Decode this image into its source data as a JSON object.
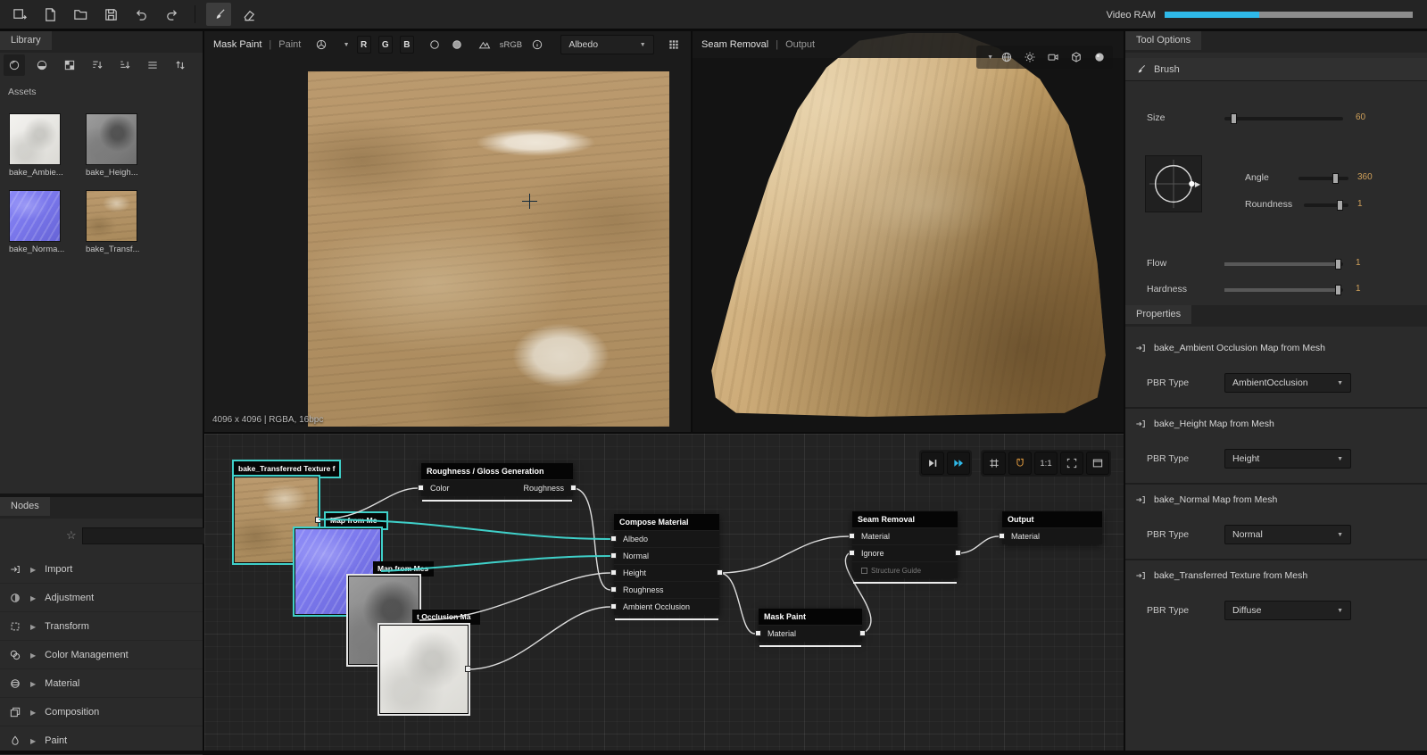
{
  "colors": {
    "accent_cyan": "#2fb9e8",
    "wire_teal": "#3fd0c9",
    "value_amber": "#cfa05a",
    "rock_tan": "#c3a06c"
  },
  "topbar": {
    "video_ram_label": "Video RAM"
  },
  "library": {
    "tab": "Library",
    "assets_label": "Assets",
    "assets": [
      {
        "name": "bake_Ambie..."
      },
      {
        "name": "bake_Heigh..."
      },
      {
        "name": "bake_Norma..."
      },
      {
        "name": "bake_Transf..."
      }
    ]
  },
  "nodes_panel": {
    "tab": "Nodes",
    "categories": [
      "Import",
      "Adjustment",
      "Transform",
      "Color Management",
      "Material",
      "Composition",
      "Paint"
    ]
  },
  "view2d": {
    "title": "Mask Paint",
    "sep": "|",
    "subtitle": "Paint",
    "channels": [
      "R",
      "G",
      "B"
    ],
    "srgb": "sRGB",
    "map_select": "Albedo",
    "status": "4096 x 4096 | RGBA, 16bpc"
  },
  "view3d": {
    "title": "Seam Removal",
    "sep": "|",
    "subtitle": "Output"
  },
  "graph": {
    "zoom_label": "1:1",
    "transferred": {
      "title": "bake_Transferred Texture f"
    },
    "normal": {
      "title": "Map from Me"
    },
    "height": {
      "title": "Map from Mes"
    },
    "ao": {
      "title": "t Occlusion Ma"
    },
    "rough": {
      "title": "Roughness / Gloss Generation",
      "input": "Color",
      "output": "Roughness"
    },
    "compose": {
      "title": "Compose Material",
      "inputs": [
        "Albedo",
        "Normal",
        "Height",
        "Roughness",
        "Ambient Occlusion"
      ]
    },
    "mask": {
      "title": "Mask Paint",
      "row": "Material"
    },
    "seam": {
      "title": "Seam Removal",
      "rows": [
        "Material",
        "Ignore",
        "Structure Guide"
      ]
    },
    "output": {
      "title": "Output",
      "row": "Material"
    }
  },
  "tool_options": {
    "header": "Tool Options",
    "brush_label": "Brush",
    "size": {
      "label": "Size",
      "value": "60"
    },
    "angle": {
      "label": "Angle",
      "value": "360"
    },
    "roundness": {
      "label": "Roundness",
      "value": "1"
    },
    "flow": {
      "label": "Flow",
      "value": "1"
    },
    "hardness": {
      "label": "Hardness",
      "value": "1"
    }
  },
  "properties": {
    "header": "Properties",
    "pbr_label": "PBR Type",
    "groups": [
      {
        "name": "bake_Ambient Occlusion Map from Mesh",
        "pbr_value": "AmbientOcclusion"
      },
      {
        "name": "bake_Height Map from Mesh",
        "pbr_value": "Height"
      },
      {
        "name": "bake_Normal Map from Mesh",
        "pbr_value": "Normal"
      },
      {
        "name": "bake_Transferred Texture from Mesh",
        "pbr_value": "Diffuse"
      }
    ]
  }
}
